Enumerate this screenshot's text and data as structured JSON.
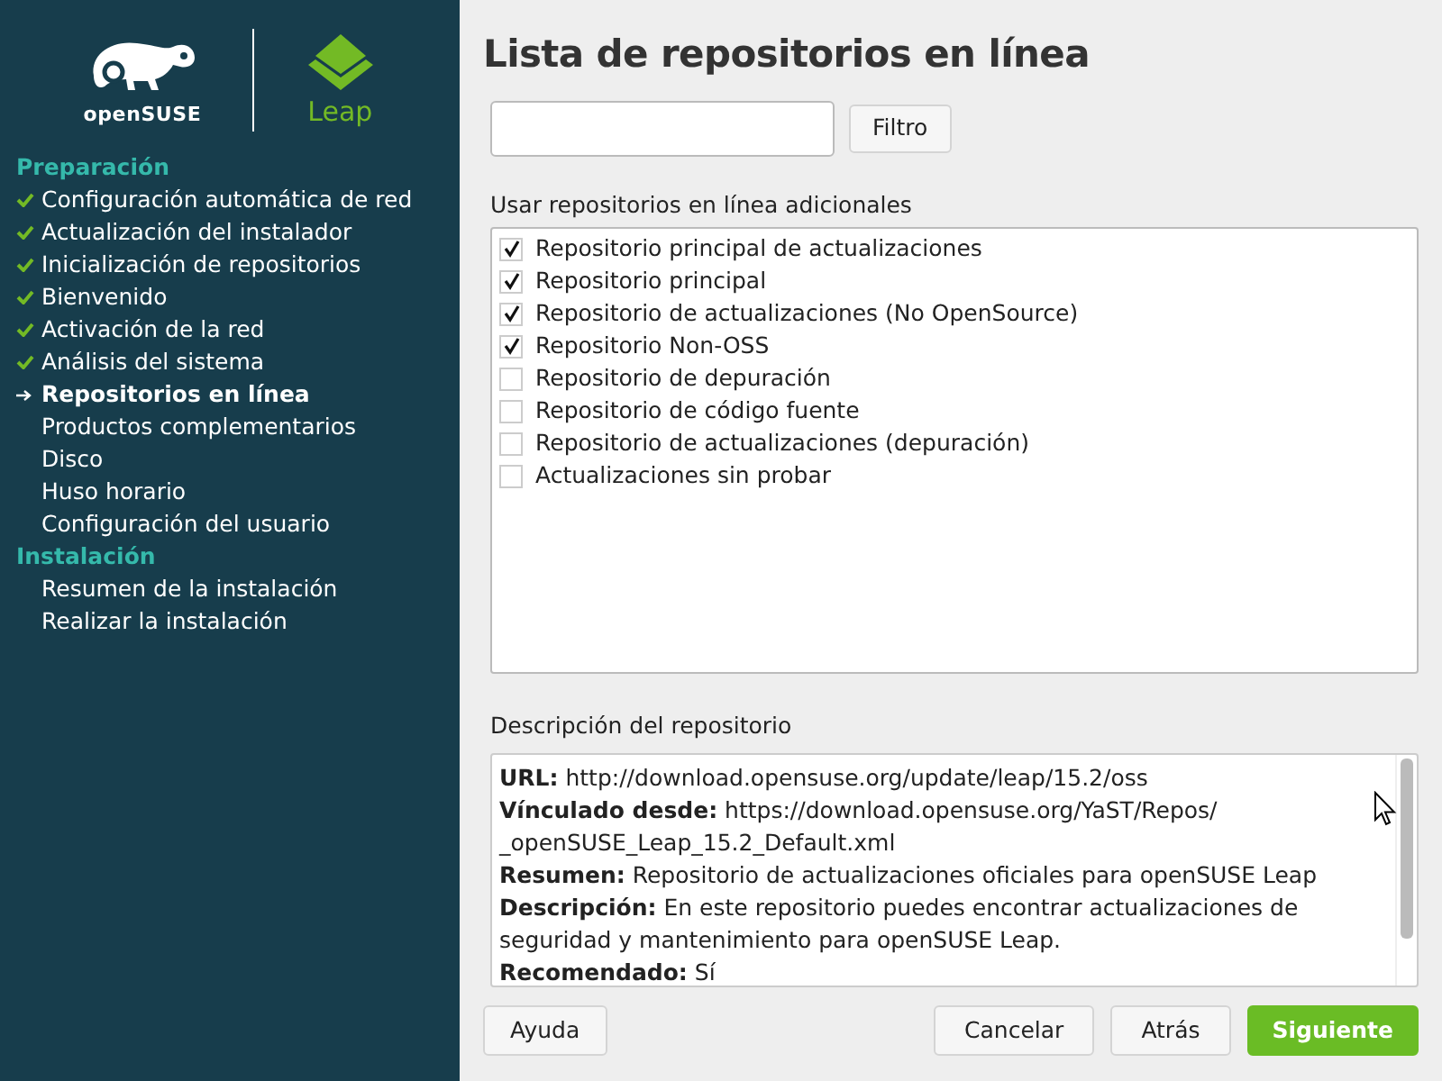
{
  "logo": {
    "brand": "openSUSE",
    "product": "Leap"
  },
  "sidebar": {
    "groups": [
      {
        "title": "Preparación",
        "items": [
          {
            "label": "Configuración automática de red",
            "kind": "done"
          },
          {
            "label": "Actualización del instalador",
            "kind": "done"
          },
          {
            "label": "Inicialización de repositorios",
            "kind": "done"
          },
          {
            "label": "Bienvenido",
            "kind": "done"
          },
          {
            "label": "Activación de la red",
            "kind": "done"
          },
          {
            "label": "Análisis del sistema",
            "kind": "done"
          },
          {
            "label": "Repositorios en línea",
            "kind": "current"
          },
          {
            "label": "Productos complementarios",
            "kind": "pending"
          },
          {
            "label": "Disco",
            "kind": "pending"
          },
          {
            "label": "Huso horario",
            "kind": "pending"
          },
          {
            "label": "Configuración del usuario",
            "kind": "pending"
          }
        ]
      },
      {
        "title": "Instalación",
        "items": [
          {
            "label": "Resumen de la instalación",
            "kind": "pending"
          },
          {
            "label": "Realizar la instalación",
            "kind": "pending"
          }
        ]
      }
    ]
  },
  "title": "Lista de repositorios en línea",
  "filter": {
    "button": "Filtro"
  },
  "repositories": {
    "label": "Usar repositorios en línea adicionales",
    "items": [
      {
        "label": "Repositorio principal de actualizaciones",
        "checked": true
      },
      {
        "label": "Repositorio principal",
        "checked": true
      },
      {
        "label": "Repositorio de actualizaciones (No OpenSource)",
        "checked": true
      },
      {
        "label": "Repositorio Non-OSS",
        "checked": true
      },
      {
        "label": "Repositorio de depuración",
        "checked": false
      },
      {
        "label": "Repositorio de código fuente",
        "checked": false
      },
      {
        "label": "Repositorio de actualizaciones (depuración)",
        "checked": false
      },
      {
        "label": "Actualizaciones sin probar",
        "checked": false
      }
    ]
  },
  "description": {
    "label": "Descripción del repositorio",
    "lines": [
      "**URL:** http://download.opensuse.org/update/leap/15.2/oss",
      "**Vínculado desde:** https://download.opensuse.org/YaST/Repos/ _openSUSE_Leap_15.2_Default.xml",
      "**Resumen:** Repositorio de actualizaciones oficiales para openSUSE Leap",
      "**Descripción:** En este repositorio puedes encontrar actualizaciones de seguridad y mantenimiento para openSUSE Leap.",
      "**Recomendado:** Sí"
    ]
  },
  "buttons": [
    {
      "label": "Ayuda",
      "kind": "help"
    },
    {
      "label": "Cancelar",
      "kind": "normal"
    },
    {
      "label": "Atrás",
      "kind": "normal"
    },
    {
      "label": "Siguiente",
      "kind": "primary"
    }
  ]
}
